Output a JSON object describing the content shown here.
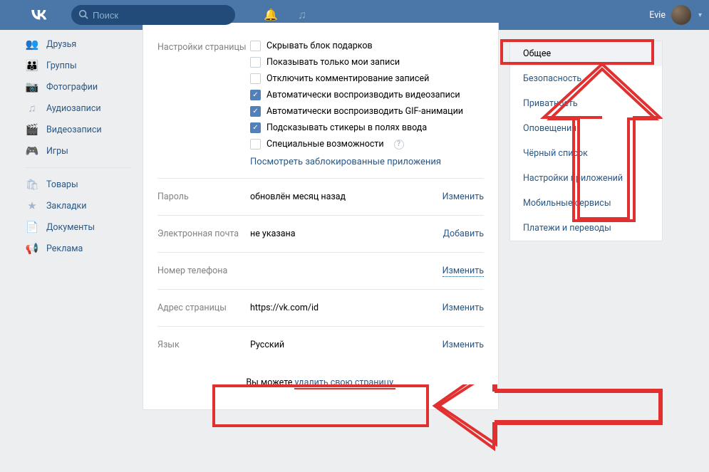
{
  "header": {
    "logo": "VK",
    "search_placeholder": "Поиск",
    "username": "Evie"
  },
  "leftnav": {
    "items": [
      {
        "icon": "👥",
        "label": "Друзья"
      },
      {
        "icon": "👪",
        "label": "Группы"
      },
      {
        "icon": "📷",
        "label": "Фотографии"
      },
      {
        "icon": "♫",
        "label": "Аудиозаписи"
      },
      {
        "icon": "🎬",
        "label": "Видеозаписи"
      },
      {
        "icon": "🎮",
        "label": "Игры"
      }
    ],
    "items2": [
      {
        "icon": "🛍",
        "label": "Товары"
      },
      {
        "icon": "★",
        "label": "Закладки"
      },
      {
        "icon": "📄",
        "label": "Документы"
      },
      {
        "icon": "📢",
        "label": "Реклама"
      }
    ]
  },
  "settings": {
    "page_label": "Настройки страницы",
    "options": [
      {
        "label": "Скрывать блок подарков",
        "checked": false
      },
      {
        "label": "Показывать только мои записи",
        "checked": false
      },
      {
        "label": "Отключить комментирование записей",
        "checked": false
      },
      {
        "label": "Автоматически воспроизводить видеозаписи",
        "checked": true
      },
      {
        "label": "Автоматически воспроизводить GIF-анимации",
        "checked": true
      },
      {
        "label": "Подсказывать стикеры в полях ввода",
        "checked": true
      },
      {
        "label": "Специальные возможности",
        "checked": false,
        "help": true
      }
    ],
    "blocked_apps_link": "Посмотреть заблокированные приложения",
    "rows": [
      {
        "label": "Пароль",
        "value": "обновлён месяц назад",
        "action": "Изменить"
      },
      {
        "label": "Электронная почта",
        "value": "не указана",
        "action": "Добавить"
      },
      {
        "label": "Номер телефона",
        "value": "",
        "action": "Изменить",
        "dotted": true
      },
      {
        "label": "Адрес страницы",
        "value": "https://vk.com/id",
        "action": "Изменить"
      },
      {
        "label": "Язык",
        "value": "Русский",
        "action": "Изменить"
      }
    ],
    "footer_prefix": "Вы можете ",
    "footer_link": "удалить свою страницу."
  },
  "rightnav": {
    "items": [
      {
        "label": "Общее",
        "active": true
      },
      {
        "label": "Безопасность"
      },
      {
        "label": "Приватность"
      },
      {
        "label": "Оповещения"
      },
      {
        "label": "Чёрный список"
      },
      {
        "label": "Настройки приложений"
      },
      {
        "label": "Мобильные сервисы"
      },
      {
        "label": "Платежи и переводы"
      }
    ]
  }
}
